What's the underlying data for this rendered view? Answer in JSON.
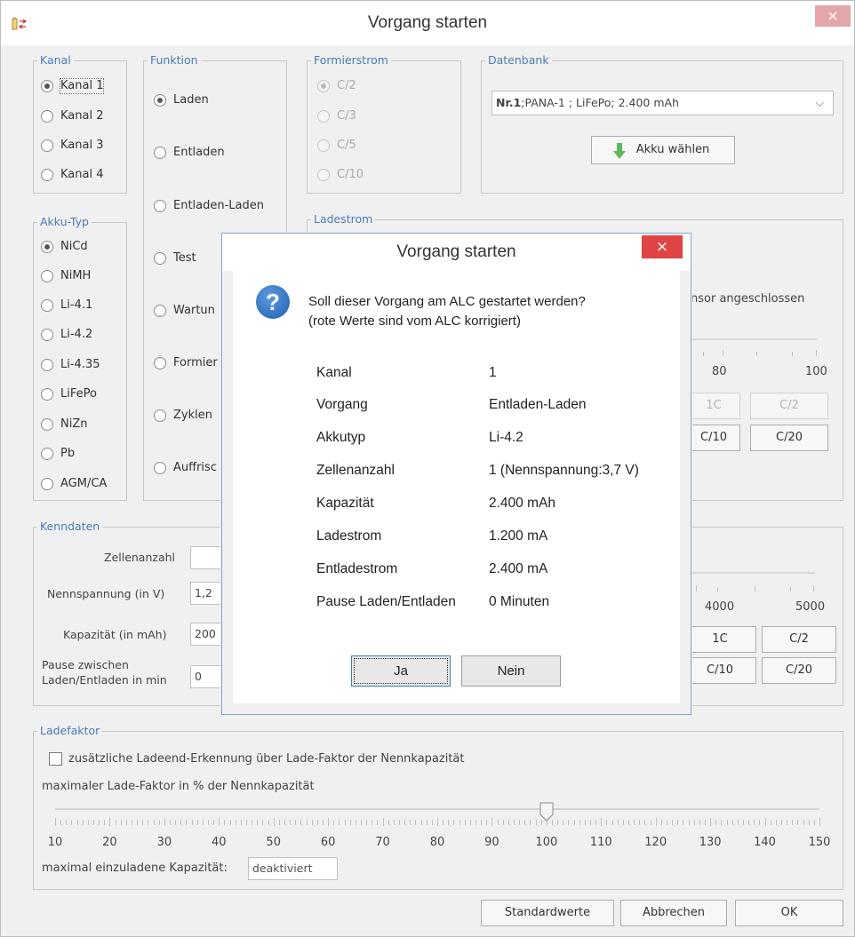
{
  "window": {
    "title": "Vorgang starten",
    "close": "×",
    "app_icon": "battery-config-icon"
  },
  "kanal": {
    "legend": "Kanal",
    "options": [
      "Kanal 1",
      "Kanal 2",
      "Kanal 3",
      "Kanal 4"
    ],
    "selected": "Kanal 1"
  },
  "funktion": {
    "legend": "Funktion",
    "options": [
      "Laden",
      "Entladen",
      "Entladen-Laden",
      "Test",
      "Wartun",
      "Formier",
      "Zyklen",
      "Auffrisc"
    ],
    "selected": "Laden"
  },
  "formierstrom": {
    "legend": "Formierstrom",
    "options": [
      "C/2",
      "C/3",
      "C/5",
      "C/10"
    ],
    "selected": "C/2"
  },
  "datenbank": {
    "legend": "Datenbank",
    "selected_bold": "Nr.1",
    "selected_rest": ";PANA-1 ; LiFePo; 2.400 mAh",
    "button": "Akku wählen"
  },
  "akku_typ": {
    "legend": "Akku-Typ",
    "options": [
      "NiCd",
      "NiMH",
      "Li-4.1",
      "Li-4.2",
      "Li-4.35",
      "LiFePo",
      "NiZn",
      "Pb",
      "AGM/CA"
    ],
    "selected": "NiCd"
  },
  "ladestrom": {
    "legend": "Ladestrom",
    "sensor_text": "nsor angeschlossen",
    "tick_labels": [
      "80",
      "100"
    ],
    "buttons": [
      "1C",
      "C/2",
      "C/10",
      "C/20"
    ]
  },
  "kenndaten": {
    "legend": "Kenndaten",
    "zellenanzahl_label": "Zellenanzahl",
    "nennspannung_label": "Nennspannung (in V)",
    "nennspannung_value": "1,2",
    "kapazitaet_label": "Kapazität (in mAh)",
    "kapazitaet_value": "200",
    "pause_label_1": "Pause zwischen",
    "pause_label_2": "Laden/Entladen in min",
    "pause_value": "0",
    "tick_labels": [
      "4000",
      "5000"
    ],
    "buttons": [
      "1C",
      "C/2",
      "C/10",
      "C/20"
    ]
  },
  "ladefaktor": {
    "legend": "Ladefaktor",
    "checkbox_label": "zusätzliche Ladeend-Erkennung über Lade-Faktor der Nennkapazität",
    "checked": false,
    "slider_label": "maximaler Lade-Faktor in % der Nennkapazität",
    "slider_value": 100,
    "slider_min": 10,
    "slider_max": 150,
    "tick_labels": [
      "10",
      "20",
      "30",
      "40",
      "50",
      "60",
      "70",
      "80",
      "90",
      "100",
      "110",
      "120",
      "130",
      "140",
      "150"
    ],
    "max_capacity_label": "maximal einzuladene Kapazität:",
    "max_capacity_value": "deaktiviert"
  },
  "footer": {
    "defaults": "Standardwerte",
    "cancel": "Abbrechen",
    "ok": "OK"
  },
  "dialog": {
    "title": "Vorgang starten",
    "close": "×",
    "question_line1": "Soll dieser Vorgang am ALC gestartet werden?",
    "question_line2": "(rote Werte sind vom ALC korrigiert)",
    "rows": [
      {
        "label": "Kanal",
        "value": "1"
      },
      {
        "label": "Vorgang",
        "value": "Entladen-Laden"
      },
      {
        "label": "Akkutyp",
        "value": "Li-4.2"
      },
      {
        "label": "Zellenanzahl",
        "value": "1 (Nennspannung:3,7 V)"
      },
      {
        "label": "Kapazität",
        "value": "2.400 mAh"
      },
      {
        "label": "Ladestrom",
        "value": "1.200 mA"
      },
      {
        "label": "Entladestrom",
        "value": "2.400 mA"
      },
      {
        "label": "Pause Laden/Entladen",
        "value": "0 Minuten"
      }
    ],
    "yes": "Ja",
    "no": "Nein"
  },
  "colors": {
    "legend": "#4a7bb5",
    "close_red": "#e04343",
    "close_inactive": "#e4a7a7",
    "akku_button_icon": "#5cb85c"
  }
}
